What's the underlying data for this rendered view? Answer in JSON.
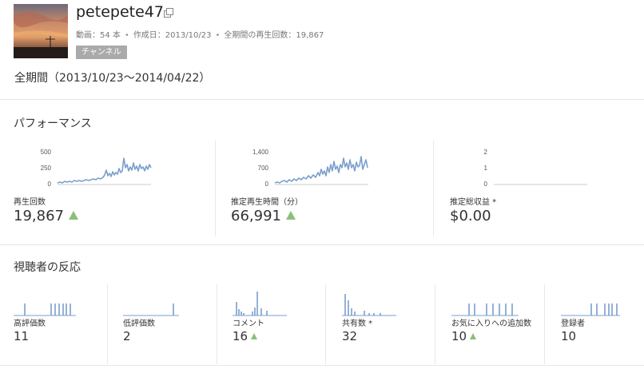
{
  "channel": {
    "name": "petepete47",
    "stats": [
      "動画：54 本",
      "作成日：2013/10/23",
      "全期間の再生回数：19,867"
    ],
    "badge": "チャンネル",
    "period": "全期間（2013/10/23～2014/04/22）"
  },
  "performance": {
    "title": "パフォーマンス",
    "cards": [
      {
        "label": "再生回数",
        "value": "19,867",
        "ticks": [
          "500",
          "250",
          "0"
        ],
        "trend": "up"
      },
      {
        "label": "推定再生時間（分）",
        "value": "66,991",
        "ticks": [
          "1,400",
          "700",
          "0"
        ],
        "trend": "up"
      },
      {
        "label": "推定総収益 *",
        "value": "$0.00",
        "ticks": [
          "2",
          "1",
          "0"
        ],
        "trend": "none"
      }
    ]
  },
  "audience": {
    "title": "視聴者の反応",
    "cards": [
      {
        "label": "高評価数",
        "value": "11",
        "trend": "none"
      },
      {
        "label": "低評価数",
        "value": "2",
        "trend": "none"
      },
      {
        "label": "コメント",
        "value": "16",
        "trend": "up"
      },
      {
        "label": "共有数 *",
        "value": "32",
        "trend": "none"
      },
      {
        "label": "お気に入りへの追加数",
        "value": "10",
        "trend": "up"
      },
      {
        "label": "登録者",
        "value": "10",
        "trend": "none"
      }
    ]
  },
  "colors": {
    "line": "#7b9fcc",
    "trend_up": "#8ac07a",
    "badge": "#aaaaaa"
  },
  "icons": {
    "external_link": "external-link-icon"
  }
}
